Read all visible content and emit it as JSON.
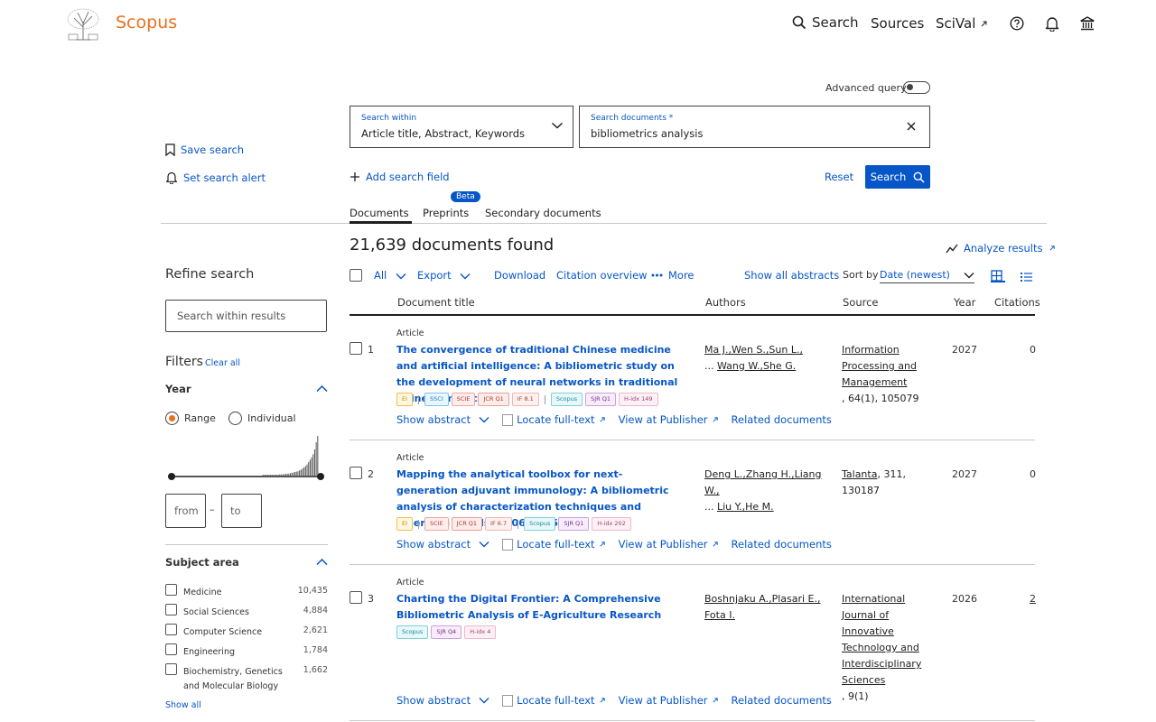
{
  "header": {
    "brand": "Scopus",
    "nav_search": "Search",
    "nav_sources": "Sources",
    "nav_scival": "SciVal"
  },
  "search": {
    "advanced_label": "Advanced query",
    "within_label": "Search within",
    "within_value": "Article title, Abstract, Keywords",
    "docs_label": "Search documents *",
    "docs_value": "bibliometrics analysis",
    "save_search": "Save search",
    "set_alert": "Set search alert",
    "add_field": "Add search field",
    "reset": "Reset",
    "search_button": "Search"
  },
  "tabs": {
    "documents": "Documents",
    "preprints": "Preprints",
    "beta": "Beta",
    "secondary": "Secondary documents"
  },
  "results_header": {
    "found": "21,639 documents found",
    "analyze": "Analyze results",
    "all": "All",
    "export": "Export",
    "download": "Download",
    "citation_overview": "Citation overview",
    "more": "More",
    "show_all_abstracts": "Show all abstracts",
    "sort_by": "Sort by",
    "sort_value": "Date (newest)"
  },
  "columns": {
    "title": "Document title",
    "authors": "Authors",
    "source": "Source",
    "year": "Year",
    "citations": "Citations"
  },
  "sidebar": {
    "refine": "Refine search",
    "search_within_placeholder": "Search within results",
    "filters": "Filters",
    "clear_all": "Clear all",
    "year_title": "Year",
    "range": "Range",
    "individual": "Individual",
    "from": "from",
    "dash": "–",
    "to": "to",
    "subject_title": "Subject area",
    "subjects": [
      {
        "name": "Medicine",
        "count": "10,435"
      },
      {
        "name": "Social Sciences",
        "count": "4,884"
      },
      {
        "name": "Computer Science",
        "count": "2,621"
      },
      {
        "name": "Engineering",
        "count": "1,784"
      },
      {
        "name": "Biochemistry, Genetics and Molecular Biology",
        "count": "1,662"
      }
    ],
    "show_all": "Show all"
  },
  "year_histogram": [
    0,
    0,
    0,
    0,
    0,
    0,
    0,
    0,
    0,
    0,
    0,
    0,
    0,
    0,
    0,
    0,
    0,
    0,
    0,
    0,
    0,
    0,
    0,
    0,
    0,
    0,
    0,
    0,
    0,
    0,
    0,
    0,
    0,
    0,
    0,
    0,
    0,
    0,
    0,
    0,
    0,
    0,
    0,
    0,
    0,
    0,
    0,
    0,
    0,
    0,
    0,
    0,
    0,
    0,
    0,
    0,
    0,
    0,
    1,
    1,
    1,
    1,
    1,
    1,
    1,
    1,
    2,
    2,
    2,
    3,
    3,
    3,
    4,
    4,
    5,
    5,
    6,
    7,
    8,
    9,
    10,
    11,
    13,
    15,
    18,
    21,
    24,
    28,
    34,
    40,
    46,
    54,
    66,
    84,
    100
  ],
  "results": [
    {
      "num": "1",
      "type": "Article",
      "title": "The convergence of traditional Chinese medicine and artificial intelligence: A bibliometric study on the development of neural networks in traditional Chinese medicine",
      "authors_line1": "Ma J.,Wen S.,Sun L.,",
      "authors_line2_prefix": "... ",
      "authors_line2": "Wang W.,She G.",
      "source_name": "Information Processing and Management",
      "source_detail": ", 64(1), 105079",
      "year": "2027",
      "citations": "0",
      "badges": [
        {
          "text": "EI",
          "kind": "ei"
        },
        {
          "text": "|",
          "kind": "sep"
        },
        {
          "text": "SSCI",
          "kind": "ssci"
        },
        {
          "text": "SCIE",
          "kind": "scie"
        },
        {
          "text": "JCR Q1",
          "kind": "jcr"
        },
        {
          "text": "IF 8.1",
          "kind": "if"
        },
        {
          "text": "|",
          "kind": "sep"
        },
        {
          "text": "Scopus",
          "kind": "scopus"
        },
        {
          "text": "SJR Q1",
          "kind": "sjr"
        },
        {
          "text": "H-idx 149",
          "kind": "hidx"
        }
      ]
    },
    {
      "num": "2",
      "type": "Article",
      "title": "Mapping the analytical toolbox for next-generation adjuvant immunology: A bibliometric analysis of characterization techniques and emerging trends (2006–2025)",
      "authors_line1": "Deng L.,Zhang H.,Liang W.,",
      "authors_line2_prefix": "... ",
      "authors_line2": "Liu Y.,He M.",
      "source_name": "Talanta",
      "source_detail": ", 311, 130187",
      "year": "2027",
      "citations": "0",
      "badges": [
        {
          "text": "EI",
          "kind": "ei"
        },
        {
          "text": "|",
          "kind": "sep"
        },
        {
          "text": "SCIE",
          "kind": "scie"
        },
        {
          "text": "JCR Q1",
          "kind": "jcr"
        },
        {
          "text": "IF 6.7",
          "kind": "if"
        },
        {
          "text": "|",
          "kind": "sep"
        },
        {
          "text": "Scopus",
          "kind": "scopus"
        },
        {
          "text": "SJR Q1",
          "kind": "sjr"
        },
        {
          "text": "H-idx 202",
          "kind": "hidx"
        }
      ]
    },
    {
      "num": "3",
      "type": "Article",
      "title": "Charting the Digital Frontier: A Comprehensive Bibliometric Analysis of E-Agriculture Research",
      "authors_line1": "Boshnjaku A.,Plasari E.,",
      "authors_line2_prefix": "",
      "authors_line2": "Fota I.",
      "source_name": "International Journal of Innovative Technology and Interdisciplinary Sciences",
      "source_detail": ", 9(1)",
      "year": "2026",
      "citations": "2",
      "badges": [
        {
          "text": "Scopus",
          "kind": "scopus"
        },
        {
          "text": "SJR Q4",
          "kind": "sjr"
        },
        {
          "text": "H-idx 4",
          "kind": "hidx"
        }
      ]
    }
  ],
  "result_links": {
    "show_abstract": "Show abstract",
    "locate": "Locate full-text",
    "view_publisher": "View at Publisher",
    "related": "Related documents"
  },
  "colors": {
    "brand_orange": "#e9711c",
    "link_blue": "#0656c7"
  }
}
